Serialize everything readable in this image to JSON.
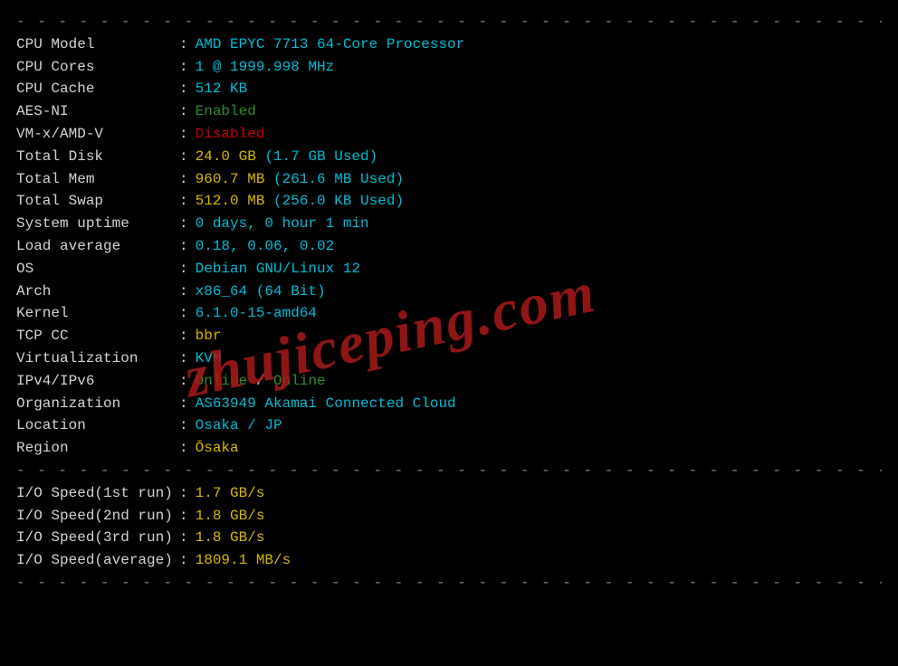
{
  "divider": "- - - - - - - - - - - - - - - - - - - - - - - - - - - - - - - - - - - - - - - - - - - - - - - - - - - - - - - - - - - - - - - - -",
  "watermark": "zhujiceping.com",
  "rows": {
    "cpu_model": {
      "label": "CPU Model",
      "value": "AMD EPYC 7713 64-Core Processor",
      "cls": "cyan"
    },
    "cpu_cores": {
      "label": "CPU Cores",
      "value": "1 @ 1999.998 MHz",
      "cls": "cyan"
    },
    "cpu_cache": {
      "label": "CPU Cache",
      "value": "512 KB",
      "cls": "cyan"
    },
    "aes_ni": {
      "label": "AES-NI",
      "value": "Enabled",
      "cls": "green"
    },
    "vmx": {
      "label": "VM-x/AMD-V",
      "value": "Disabled",
      "cls": "red"
    },
    "total_disk": {
      "label": "Total Disk",
      "value": "24.0 GB",
      "cls": "yellow",
      "extra": "(1.7 GB Used)",
      "extra_cls": "cyan"
    },
    "total_mem": {
      "label": "Total Mem",
      "value": "960.7 MB",
      "cls": "yellow",
      "extra": "(261.6 MB Used)",
      "extra_cls": "cyan"
    },
    "total_swap": {
      "label": "Total Swap",
      "value": "512.0 MB",
      "cls": "yellow",
      "extra": "(256.0 KB Used)",
      "extra_cls": "cyan"
    },
    "uptime": {
      "label": "System uptime",
      "value": "0 days, 0 hour 1 min",
      "cls": "cyan"
    },
    "load_avg": {
      "label": "Load average",
      "value": "0.18, 0.06, 0.02",
      "cls": "cyan"
    },
    "os": {
      "label": "OS",
      "value": "Debian GNU/Linux 12",
      "cls": "cyan"
    },
    "arch": {
      "label": "Arch",
      "value": "x86_64 (64 Bit)",
      "cls": "cyan"
    },
    "kernel": {
      "label": "Kernel",
      "value": "6.1.0-15-amd64",
      "cls": "cyan"
    },
    "tcp_cc": {
      "label": "TCP CC",
      "value": "bbr",
      "cls": "yellow"
    },
    "virt": {
      "label": "Virtualization",
      "value": "KVM",
      "cls": "cyan"
    },
    "ipv": {
      "label": "IPv4/IPv6",
      "a": "Online",
      "sep": " / ",
      "b": "Online"
    },
    "org": {
      "label": "Organization",
      "value": "AS63949 Akamai Connected Cloud",
      "cls": "cyan"
    },
    "location": {
      "label": "Location",
      "value": "Osaka / JP",
      "cls": "cyan"
    },
    "region": {
      "label": "Region",
      "value": "Ōsaka",
      "cls": "yellow"
    }
  },
  "io": {
    "r1": {
      "label": "I/O Speed(1st run)",
      "value": "1.7 GB/s"
    },
    "r2": {
      "label": "I/O Speed(2nd run)",
      "value": "1.8 GB/s"
    },
    "r3": {
      "label": "I/O Speed(3rd run)",
      "value": "1.8 GB/s"
    },
    "avg": {
      "label": "I/O Speed(average)",
      "value": "1809.1 MB/s"
    }
  }
}
